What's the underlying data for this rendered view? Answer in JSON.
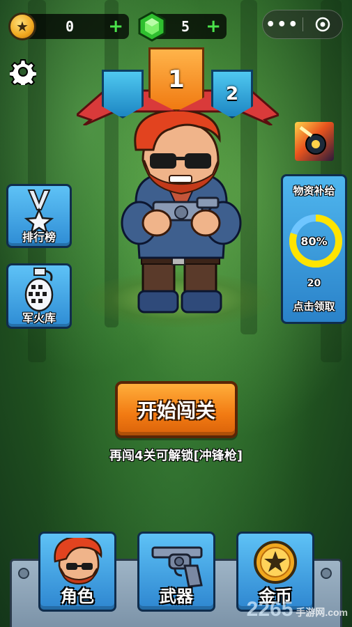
{
  "top_bar": {
    "coins": "0",
    "gems": "5",
    "coin_add": "+",
    "gem_add": "+",
    "menu_dots": "•••"
  },
  "levels": {
    "current": "1",
    "next": "2"
  },
  "side_menu": {
    "leaderboard_label": "排行榜",
    "armory_label": "军火库"
  },
  "supply": {
    "title": "物资补给",
    "progress_text": "80%",
    "progress": 0.8,
    "count": "20",
    "claim_label": "点击领取"
  },
  "main": {
    "start_label": "开始闯关",
    "unlock_hint": "再闯4关可解锁[冲锋枪]"
  },
  "bottom_nav": {
    "character_label": "角色",
    "weapon_label": "武器",
    "coins_label": "金币"
  },
  "watermark": {
    "logo": "2265",
    "sub": "手游网",
    "domain": ".com"
  },
  "colors": {
    "accent_orange": "#f27a12",
    "panel_blue": "#3fa3e6",
    "ring_yellow": "#ffe400",
    "plus_green": "#4be34b"
  },
  "icons": {
    "coin": "star-coin-icon",
    "gem": "green-gem-icon",
    "settings": "gear-icon",
    "leaderboard": "medal-icon",
    "armory": "grenade-icon",
    "weapon": "revolver-icon"
  }
}
